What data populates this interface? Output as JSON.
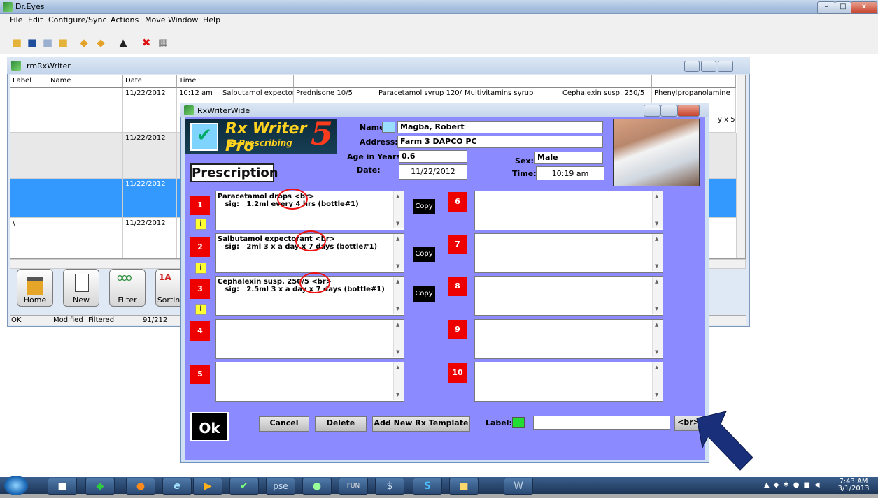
{
  "app": {
    "title": "Dr.Eyes",
    "menu": [
      "File",
      "Edit",
      "Configure/Sync",
      "Actions",
      "Move",
      "Window",
      "Help"
    ],
    "window_buttons": {
      "minimize": "–",
      "maximize": "□",
      "close": "x"
    }
  },
  "toolbar_icons": [
    "new-doc-icon",
    "save-icon",
    "save-disabled-icon",
    "notes-icon",
    "open-folder-icon",
    "export-icon",
    "print-icon",
    "delete-icon",
    "grid-icon"
  ],
  "rm_window": {
    "title": "rmRxWriter",
    "headers": [
      "Label",
      "Name",
      "Date",
      "Time",
      "",
      "",
      "",
      "",
      "",
      ""
    ],
    "rows": [
      {
        "label": "",
        "name": "",
        "date": "11/22/2012",
        "time": "10:12 am",
        "c1": "Salbutamol expectorant",
        "c2": "Prednisone 10/5",
        "c3": "Paracetamol syrup 120/5",
        "c4": "Multivitamins syrup",
        "c5": "Cephalexin susp. 250/5",
        "c6": "Phenylpropanolamine",
        "extra": "y x 5"
      },
      {
        "label": "",
        "name": "",
        "date": "11/22/2012",
        "time": "1"
      },
      {
        "label": "",
        "name": "",
        "date": "11/22/2012",
        "time": ""
      },
      {
        "label": "\\",
        "name": "",
        "date": "11/22/2012",
        "time": "1"
      }
    ],
    "buttons": [
      "Home",
      "New",
      "Filter",
      "Sortin"
    ],
    "status": {
      "ok": "OK",
      "modified": "Modified",
      "filtered": "Filtered",
      "count": "91/212"
    }
  },
  "rx_dialog": {
    "title": "RxWriterWide",
    "logo": {
      "line1": "Rx Writer Pro",
      "line2": "e-Prescribing",
      "number": "5"
    },
    "labels": {
      "name": "Name:",
      "address": "Address:",
      "age": "Age in Years:",
      "date": "Date:",
      "sex": "Sex:",
      "time": "Time:"
    },
    "patient": {
      "name": "Magba, Robert",
      "address": "Farm 3 DAPCO PC",
      "age": "0.6",
      "date": "11/22/2012",
      "sex": "Male",
      "time": "10:19 am"
    },
    "prescription_label": "Prescription",
    "rx": [
      {
        "num": "1",
        "text": "Paracetamol drops <br>\n   sig:   1.2ml every 4 hrs (bottle#1)"
      },
      {
        "num": "2",
        "text": "Salbutamol expectorant <br>\n   sig:   2ml 3 x a day x 7 days (bottle#1)"
      },
      {
        "num": "3",
        "text": "Cephalexin susp. 250/5 <br>\n   sig:   2.5ml 3 x a day x 7 days (bottle#1)"
      },
      {
        "num": "4",
        "text": ""
      },
      {
        "num": "5",
        "text": ""
      },
      {
        "num": "6",
        "text": ""
      },
      {
        "num": "7",
        "text": ""
      },
      {
        "num": "8",
        "text": ""
      },
      {
        "num": "9",
        "text": ""
      },
      {
        "num": "10",
        "text": ""
      }
    ],
    "copy_label": "Copy",
    "info_label": "i",
    "buttons": {
      "ok": "Ok",
      "cancel": "Cancel",
      "delete": "Delete",
      "add": "Add New Rx Template",
      "br": "<br>"
    },
    "label_field_label": "Label:",
    "label_value": ""
  },
  "taskbar": {
    "items": [
      "folder-icon",
      "app-icon",
      "firefox-icon",
      "ie-icon",
      "media-icon",
      "rxwriter-icon",
      "pse-icon",
      "user-icon",
      "fun-icon",
      "dollar-icon",
      "skype-icon",
      "explorer-icon",
      "word-icon"
    ],
    "pse_label": "pse",
    "fun_label": "FUN",
    "time": "7:43 AM",
    "date": "3/1/2013"
  },
  "colors": {
    "dialog_bg": "#8b8bff",
    "rx_number": "#ee0000",
    "selected_row": "#3399ff",
    "arrow": "#1a2f7a",
    "annotation_circle": "#e11111"
  }
}
